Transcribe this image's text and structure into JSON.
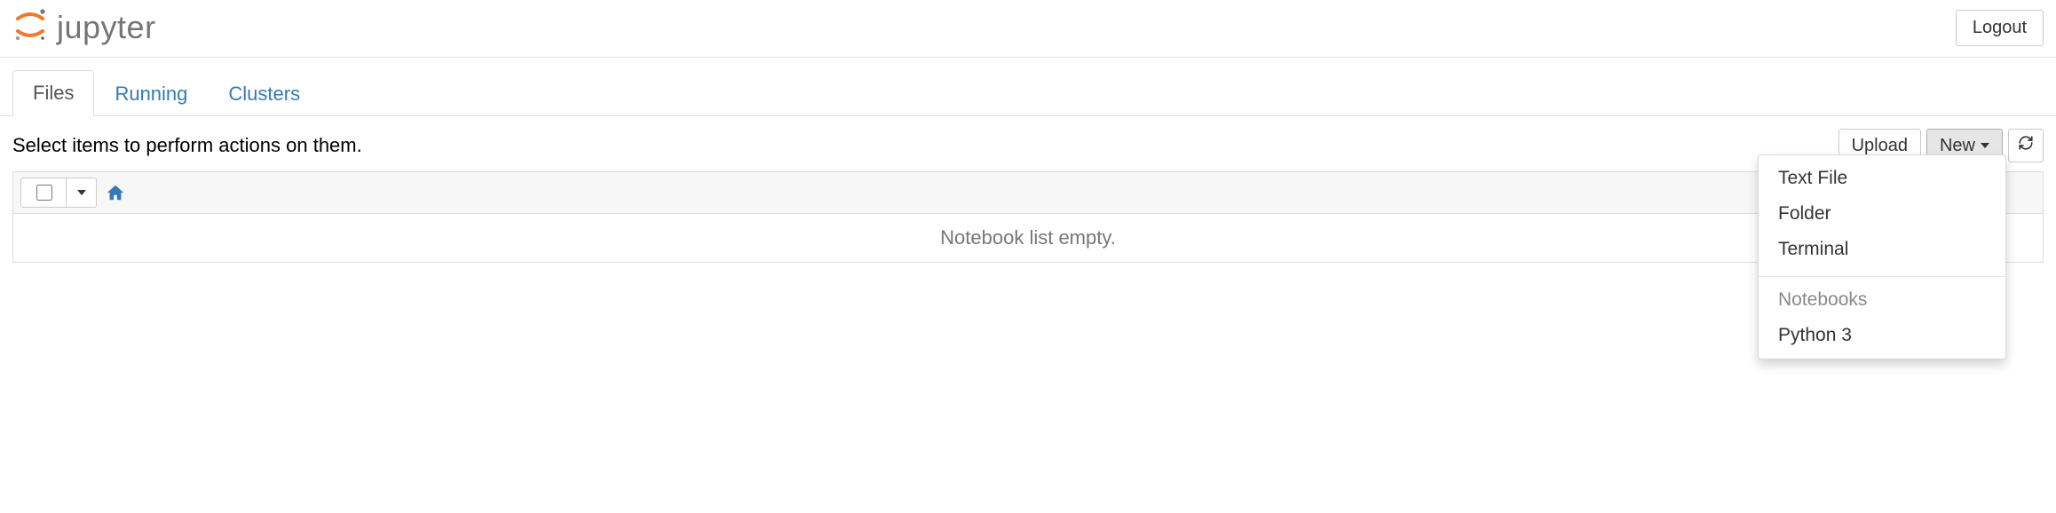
{
  "header": {
    "brand": "jupyter",
    "logout_label": "Logout"
  },
  "tabs": {
    "files": "Files",
    "running": "Running",
    "clusters": "Clusters"
  },
  "toolbar": {
    "instruction": "Select items to perform actions on them.",
    "upload_label": "Upload",
    "new_label": "New"
  },
  "list": {
    "empty_message": "Notebook list empty."
  },
  "new_menu": {
    "text_file": "Text File",
    "folder": "Folder",
    "terminal": "Terminal",
    "notebooks_header": "Notebooks",
    "python3": "Python 3"
  }
}
